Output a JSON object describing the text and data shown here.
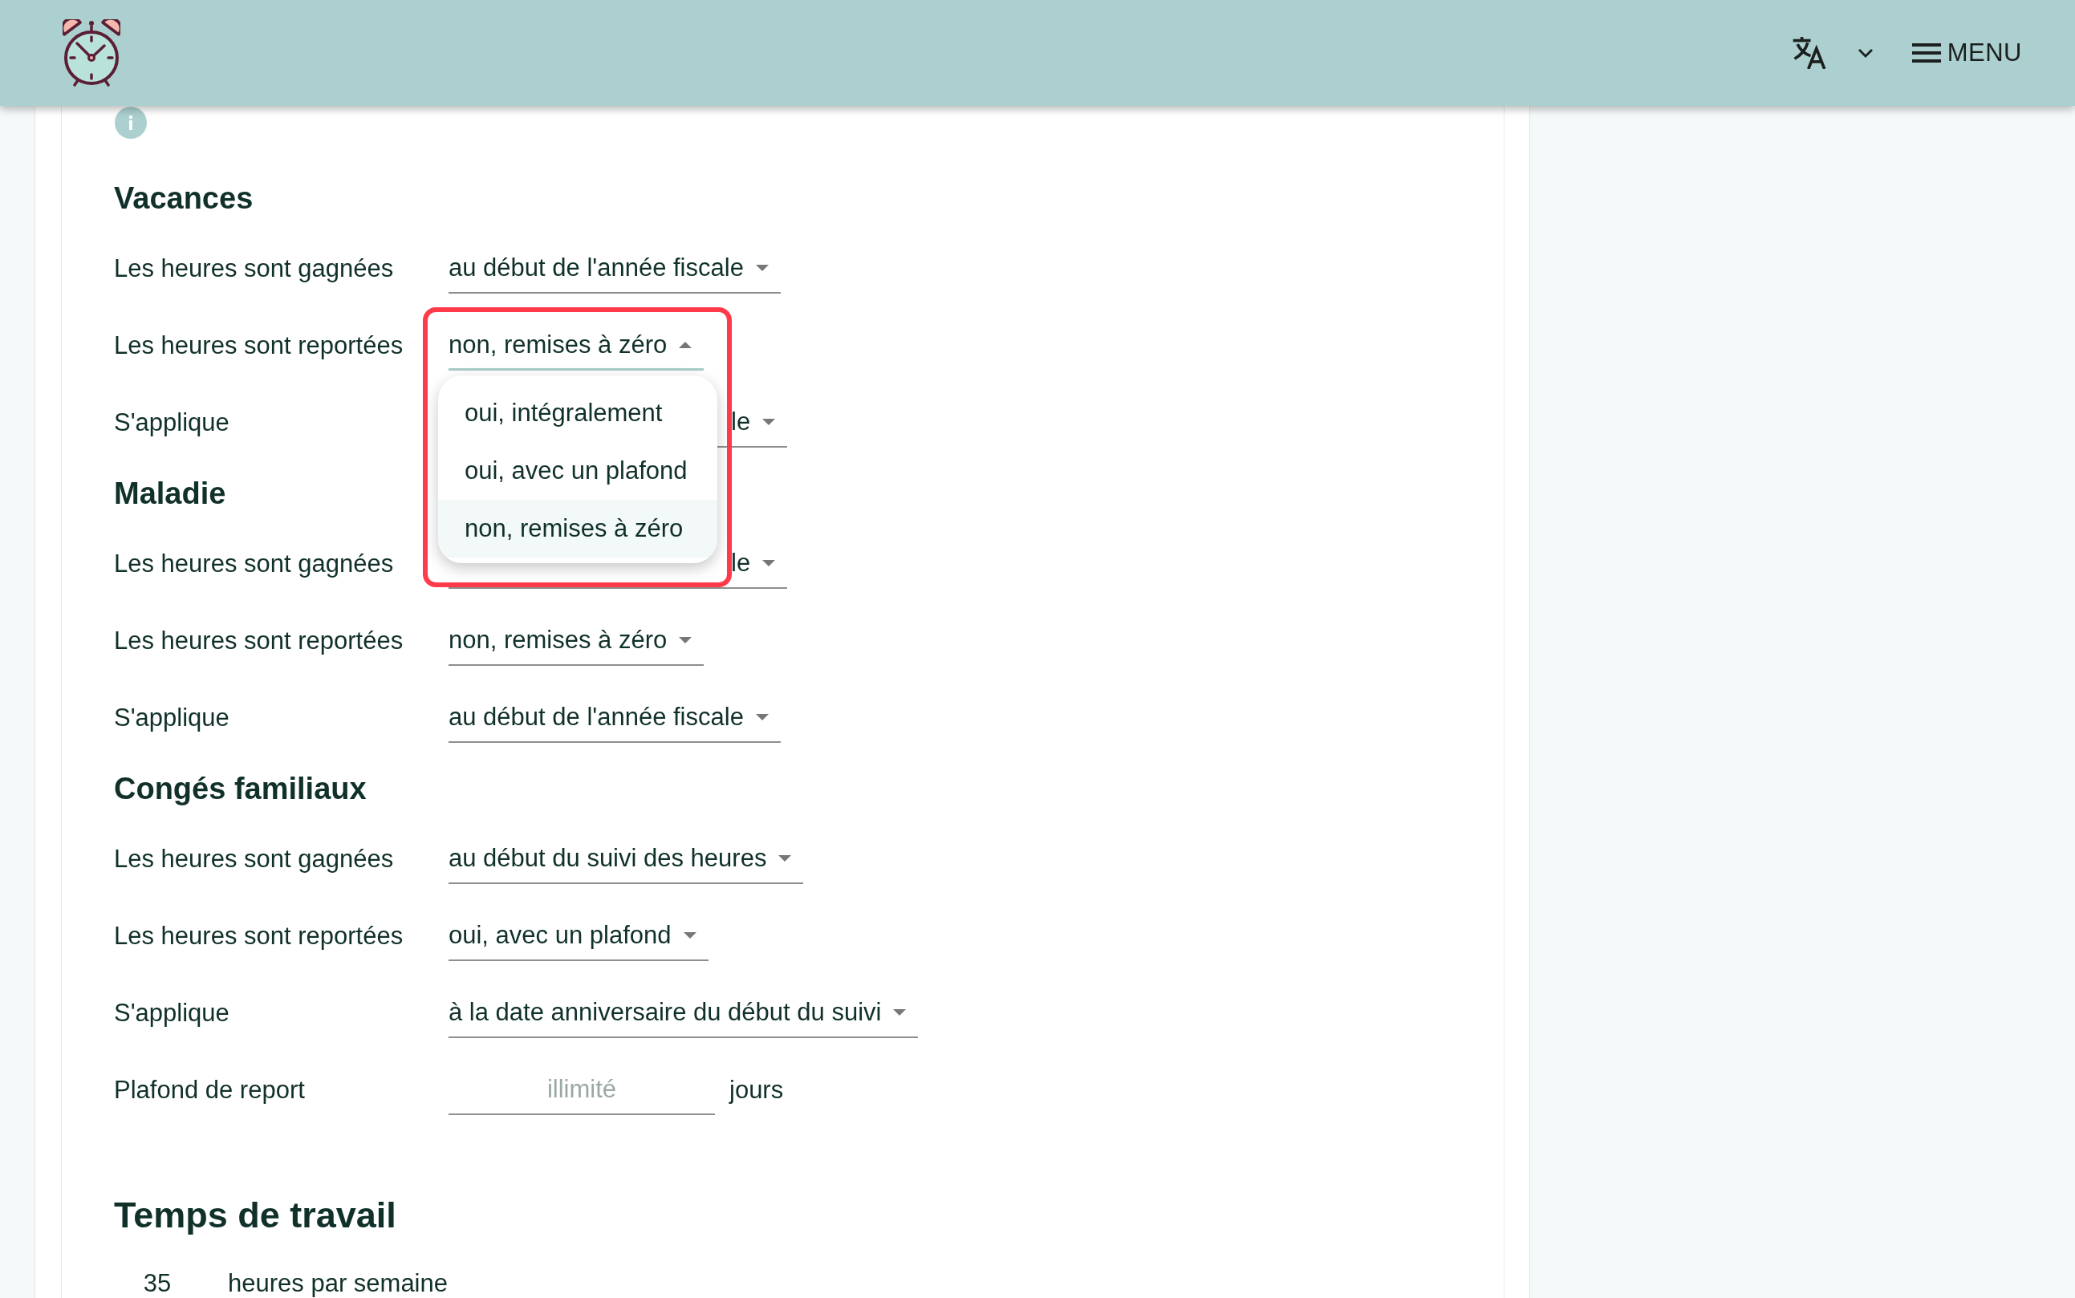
{
  "header": {
    "menu_button": {
      "label": "MENU"
    }
  },
  "sections": [
    {
      "title": "Vacances",
      "rows": [
        {
          "kind": "select",
          "label": "Les heures sont gagnées",
          "value": "au début de l'année fiscale",
          "open": false,
          "highlighted": false
        },
        {
          "kind": "select",
          "label": "Les heures sont reportées",
          "value": "non, remises à zéro",
          "open": true,
          "highlighted": true,
          "options": [
            {
              "label": "oui, intégralement",
              "selected": false
            },
            {
              "label": "oui, avec un plafond",
              "selected": false
            },
            {
              "label": "non, remises à zéro",
              "selected": true
            }
          ]
        },
        {
          "kind": "select",
          "label": "S'applique",
          "value": "le",
          "open": false,
          "highlighted": false,
          "partly_hidden": true
        }
      ]
    },
    {
      "title": "Maladie",
      "rows": [
        {
          "kind": "select",
          "label": "Les heures sont gagnées",
          "value": "le",
          "open": false,
          "highlighted": false,
          "partly_hidden": true
        },
        {
          "kind": "select",
          "label": "Les heures sont reportées",
          "value": "non, remises à zéro",
          "open": false,
          "highlighted": false
        },
        {
          "kind": "select",
          "label": "S'applique",
          "value": "au début de l'année fiscale",
          "open": false,
          "highlighted": false
        }
      ]
    },
    {
      "title": "Congés familiaux",
      "rows": [
        {
          "kind": "select",
          "label": "Les heures sont gagnées",
          "value": "au début du suivi des heures",
          "open": false,
          "highlighted": false
        },
        {
          "kind": "select",
          "label": "Les heures sont reportées",
          "value": "oui, avec un plafond",
          "open": false,
          "highlighted": false
        },
        {
          "kind": "select",
          "label": "S'applique",
          "value": "à la date anniversaire du début du suivi",
          "open": false,
          "highlighted": false
        },
        {
          "kind": "number",
          "label": "Plafond de report",
          "placeholder": "illimité",
          "unit": "jours"
        }
      ]
    }
  ],
  "working_time": {
    "title": "Temps de travail",
    "hours": {
      "value": "35",
      "unit": "heures par semaine"
    }
  }
}
